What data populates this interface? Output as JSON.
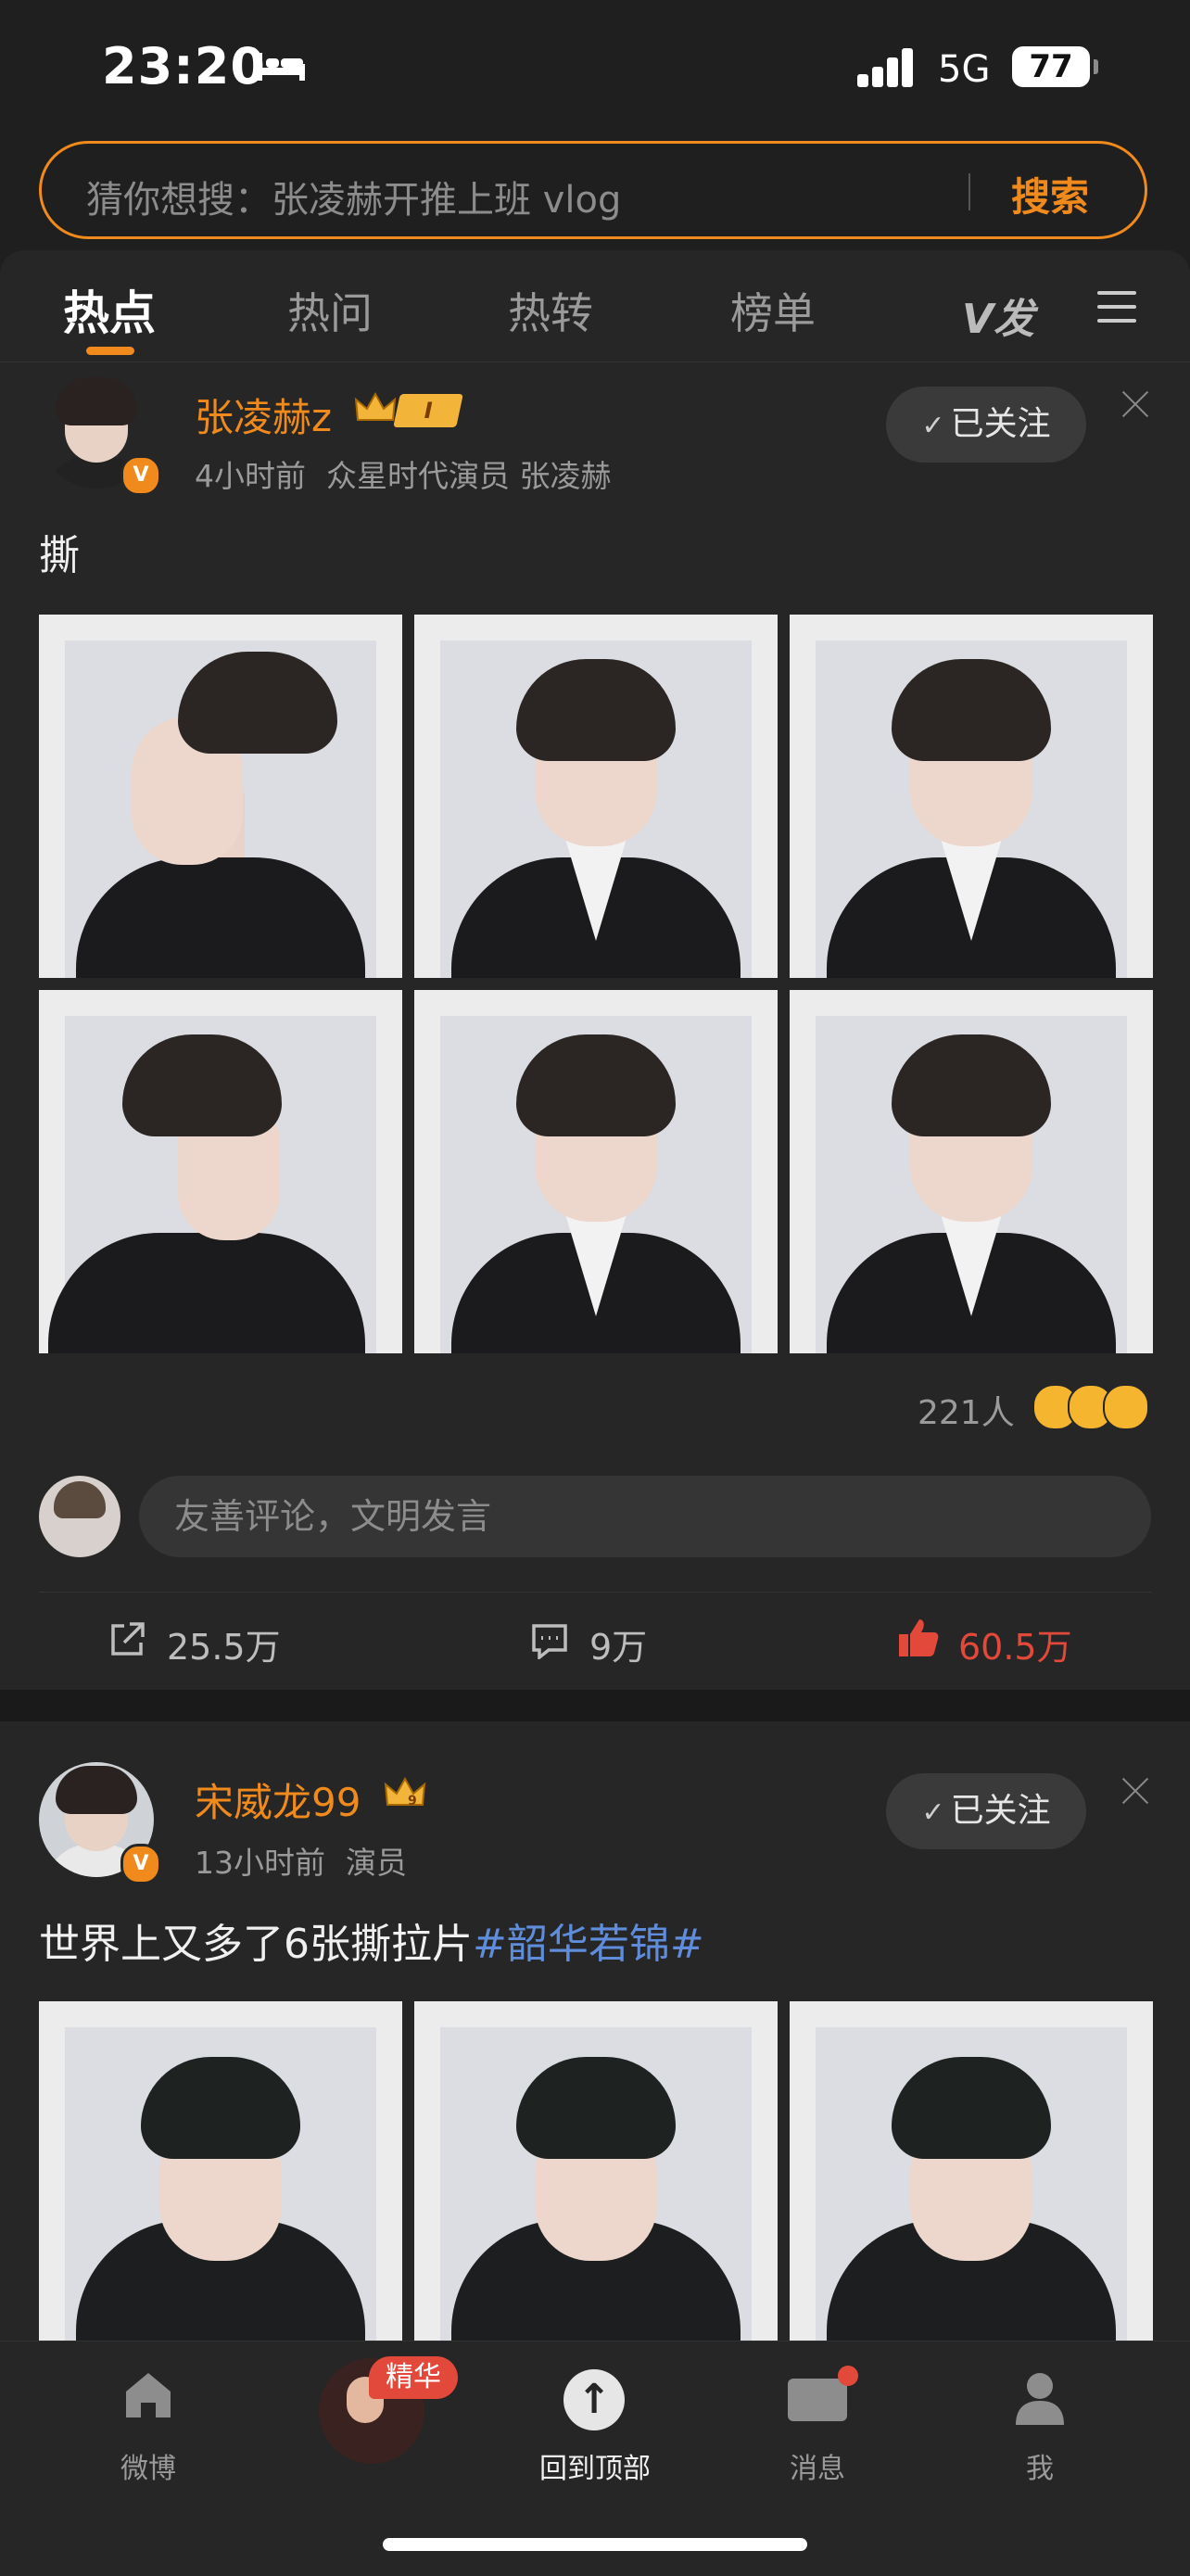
{
  "status": {
    "time": "23:20",
    "network": "5G",
    "battery": "77"
  },
  "search": {
    "placeholder": "猜你想搜：张凌赫开推上班 vlog",
    "button": "搜索"
  },
  "tabs": [
    "热点",
    "热问",
    "热转",
    "榜单"
  ],
  "tab_logo": "V发",
  "posts": [
    {
      "username": "张凌赫z",
      "level": "I",
      "time": "4小时前",
      "source": "众星时代演员 张凌赫",
      "follow_label": "已关注",
      "text": "撕",
      "reaction_count": "221人",
      "comment_placeholder": "友善评论，文明发言",
      "shares": "25.5万",
      "comments": "9万",
      "likes": "60.5万"
    },
    {
      "username": "宋威龙99",
      "level_badge": "9",
      "time": "13小时前",
      "source": "演员",
      "follow_label": "已关注",
      "text": "世界上又多了6张撕拉片",
      "hashtag": "#韶华若锦#"
    }
  ],
  "bottom_nav": {
    "weibo": "微博",
    "highlight_badge": "精华",
    "back_to_top": "回到顶部",
    "messages": "消息",
    "me": "我"
  },
  "colors": {
    "accent": "#f08a1c",
    "liked": "#e2493b",
    "hashtag": "#5f8ddb",
    "background": "#1f1f1f",
    "card": "#262626"
  }
}
